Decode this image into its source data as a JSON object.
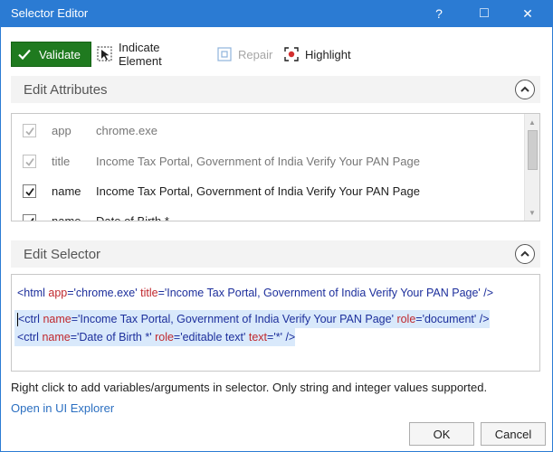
{
  "window": {
    "title": "Selector Editor"
  },
  "title_buttons": {
    "help": "?",
    "maximize": "□",
    "close": "✕"
  },
  "toolbar": {
    "validate_label": "Validate",
    "indicate_label": "Indicate Element",
    "repair_label": "Repair",
    "highlight_label": "Highlight"
  },
  "edit_attributes": {
    "title": "Edit Attributes",
    "rows": [
      {
        "name": "app",
        "value": "chrome.exe",
        "checked": true,
        "enabled": false
      },
      {
        "name": "title",
        "value": "Income Tax Portal, Government of India Verify Your PAN Page",
        "checked": true,
        "enabled": false
      },
      {
        "name": "name",
        "value": "Income Tax Portal, Government of India Verify Your PAN Page",
        "checked": true,
        "enabled": true
      },
      {
        "name": "name",
        "value": "Date of Birth *",
        "checked": true,
        "enabled": true
      }
    ]
  },
  "edit_selector": {
    "title": "Edit Selector",
    "line1": {
      "open": "<html ",
      "a1": "app",
      "v1": "='chrome.exe' ",
      "a2": "title",
      "v2": "='Income Tax Portal, Government of India Verify Your PAN Page' />"
    },
    "line2": {
      "open": "<ctrl ",
      "a1": "name",
      "v1": "='Income Tax Portal, Government of India Verify Your PAN Page' ",
      "a2": "role",
      "v2": "='document' />"
    },
    "line3": {
      "open": "<ctrl ",
      "a1": "name",
      "v1": "='Date of Birth *' ",
      "a2": "role",
      "v2": "='editable text' ",
      "a3": "text",
      "v3": "='*' />"
    }
  },
  "hint_text": "Right click to add variables/arguments in selector. Only string and integer values supported.",
  "link_text": "Open in UI Explorer",
  "buttons": {
    "ok": "OK",
    "cancel": "Cancel"
  },
  "colors": {
    "titlebar": "#2b7bd3",
    "validate": "#1f7a1f",
    "tag": "#1d2f9c",
    "attr": "#c0282e",
    "link": "#2b6fc1"
  }
}
